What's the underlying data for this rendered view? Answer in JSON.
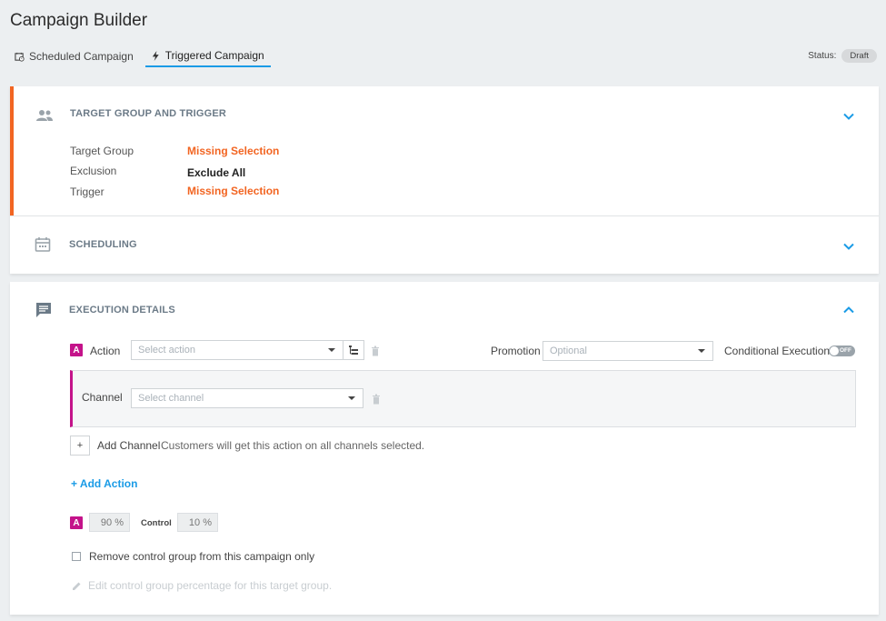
{
  "page": {
    "title": "Campaign Builder"
  },
  "tabs": [
    {
      "label": "Scheduled Campaign",
      "icon": "calendar-clock-icon"
    },
    {
      "label": "Triggered Campaign",
      "icon": "lightning-icon",
      "active": true
    }
  ],
  "status": {
    "label": "Status:",
    "value": "Draft"
  },
  "target": {
    "title": "TARGET GROUP AND TRIGGER",
    "rows": [
      {
        "label": "Target Group",
        "value": "Missing Selection",
        "state": "missing"
      },
      {
        "label": "Exclusion",
        "value": "Exclude All",
        "state": "ok"
      },
      {
        "label": "Trigger",
        "value": "Missing Selection",
        "state": "missing"
      }
    ]
  },
  "scheduling": {
    "title": "SCHEDULING"
  },
  "execution": {
    "title": "EXECUTION DETAILS",
    "action_badge": "A",
    "action_label": "Action",
    "action_placeholder": "Select action",
    "promotion_label": "Promotion",
    "promotion_placeholder": "Optional",
    "conditional_label": "Conditional Execution",
    "conditional_state": "OFF",
    "channel_label": "Channel",
    "channel_placeholder": "Select channel",
    "add_channel_icon": "+",
    "add_channel_label": "Add Channel",
    "add_channel_hint": "Customers will get this action on all channels selected.",
    "add_action_label": "+ Add Action",
    "split_badge": "A",
    "split_value": "90 %",
    "control_label": "Control",
    "control_value": "10 %",
    "remove_control_label": "Remove control group from this campaign only",
    "edit_control_label": "Edit control group percentage for this target group."
  },
  "colors": {
    "accent": "#1a9be6",
    "warning": "#f26522",
    "variant": "#c4138a"
  }
}
